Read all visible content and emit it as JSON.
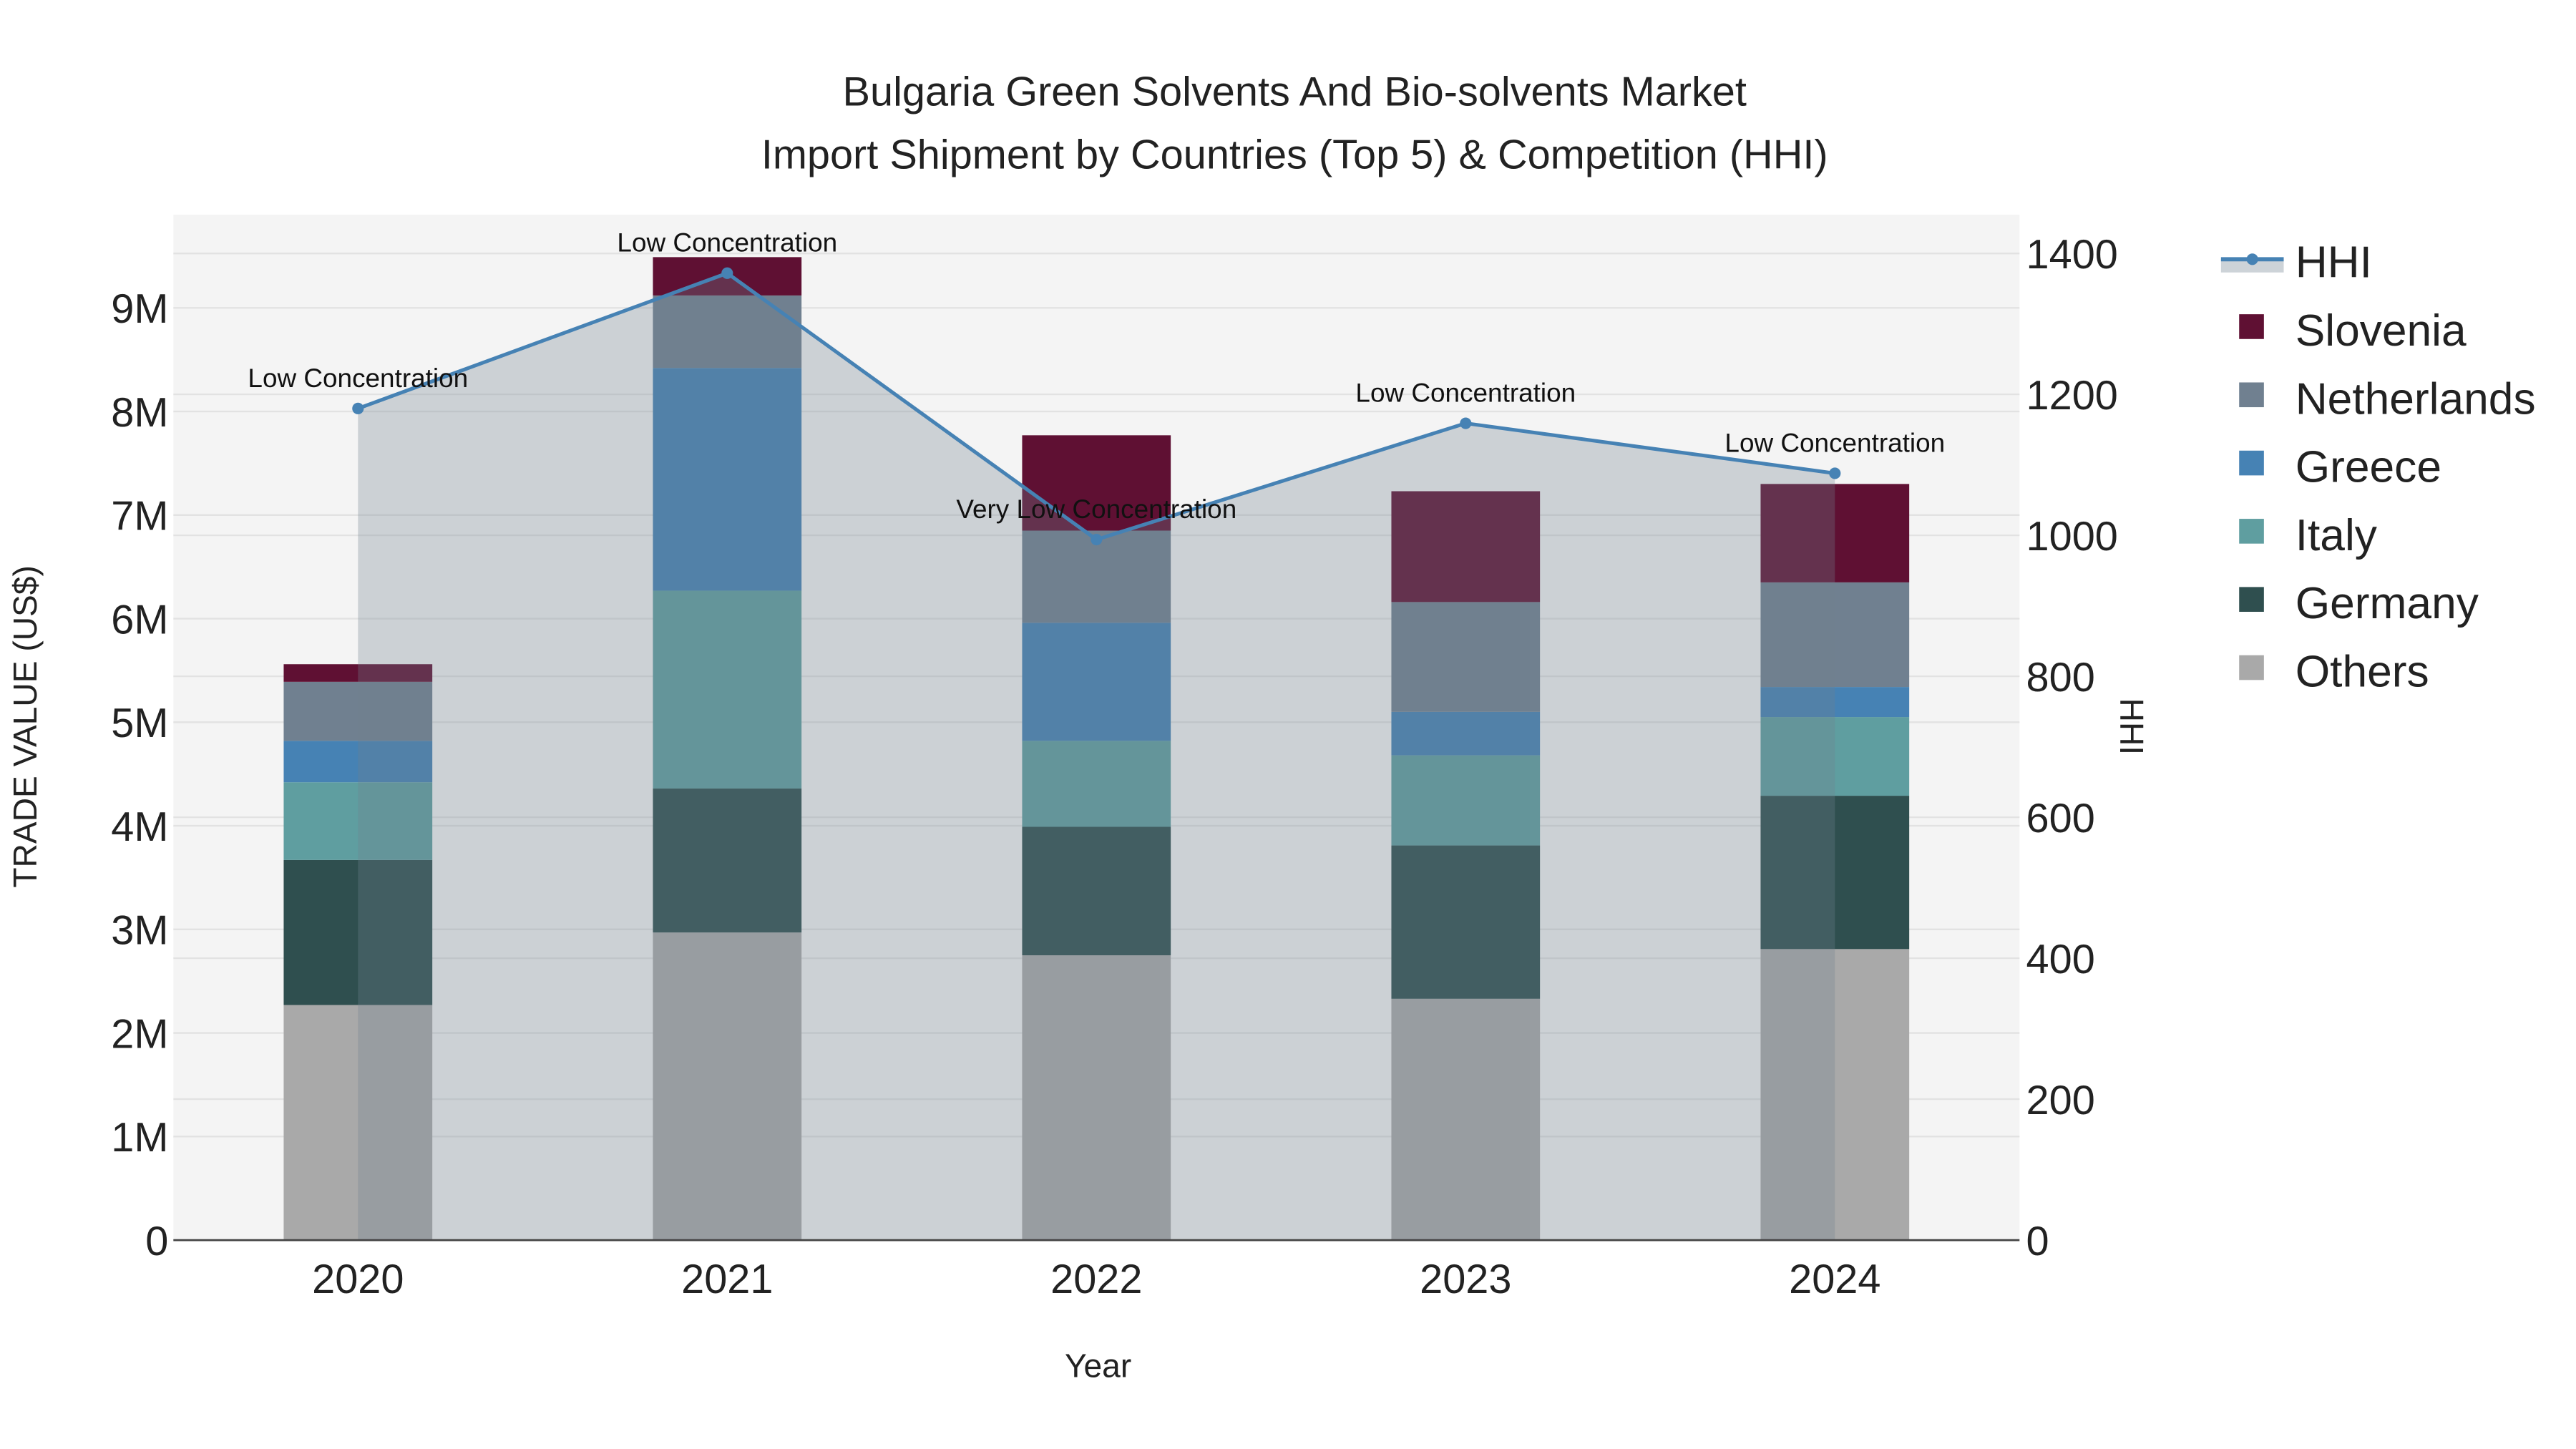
{
  "chart_data": {
    "type": "bar",
    "title_line1": "Bulgaria Green Solvents And Bio-solvents Market",
    "title_line2": "Import Shipment by Countries (Top 5) & Competition (HHI)",
    "xlabel": "Year",
    "ylabel": "TRADE VALUE (US$)",
    "y2label": "HHI",
    "categories": [
      "2020",
      "2021",
      "2022",
      "2023",
      "2024"
    ],
    "ylim": [
      0,
      9.9
    ],
    "y_unit": "millions US$",
    "yticks": [
      0,
      1,
      2,
      3,
      4,
      5,
      6,
      7,
      8,
      9
    ],
    "ytick_labels": [
      "0",
      "1M",
      "2M",
      "3M",
      "4M",
      "5M",
      "6M",
      "7M",
      "8M",
      "9M"
    ],
    "y2lim": [
      0,
      1455
    ],
    "y2ticks": [
      0,
      200,
      400,
      600,
      800,
      1000,
      1200,
      1400
    ],
    "y2tick_labels": [
      "0",
      "200",
      "400",
      "600",
      "800",
      "1000",
      "1200",
      "1400"
    ],
    "grid": true,
    "legend_position": "right",
    "series": [
      {
        "name": "Others",
        "color": "#a9a9a9",
        "values": [
          2.27,
          2.97,
          2.75,
          2.33,
          2.81
        ]
      },
      {
        "name": "Germany",
        "color": "#2f4f4f",
        "values": [
          1.4,
          1.39,
          1.24,
          1.48,
          1.48
        ]
      },
      {
        "name": "Italy",
        "color": "#5f9ea0",
        "values": [
          0.75,
          1.91,
          0.83,
          0.87,
          0.76
        ]
      },
      {
        "name": "Greece",
        "color": "#4682b4",
        "values": [
          0.4,
          2.15,
          1.14,
          0.42,
          0.29
        ]
      },
      {
        "name": "Netherlands",
        "color": "#708090",
        "values": [
          0.57,
          0.7,
          0.89,
          1.06,
          1.01
        ]
      },
      {
        "name": "Slovenia",
        "color": "#5f1033",
        "values": [
          0.17,
          0.37,
          0.92,
          1.07,
          0.95
        ]
      }
    ],
    "hhi": {
      "name": "HHI",
      "color": "#4682b4",
      "values": [
        1180,
        1372,
        994,
        1159,
        1088
      ],
      "annotations": [
        "Low Concentration",
        "Low Concentration",
        "Very Low Concentration",
        "Low Concentration",
        "Low Concentration"
      ]
    },
    "legend_order": [
      "HHI",
      "Slovenia",
      "Netherlands",
      "Greece",
      "Italy",
      "Germany",
      "Others"
    ]
  }
}
